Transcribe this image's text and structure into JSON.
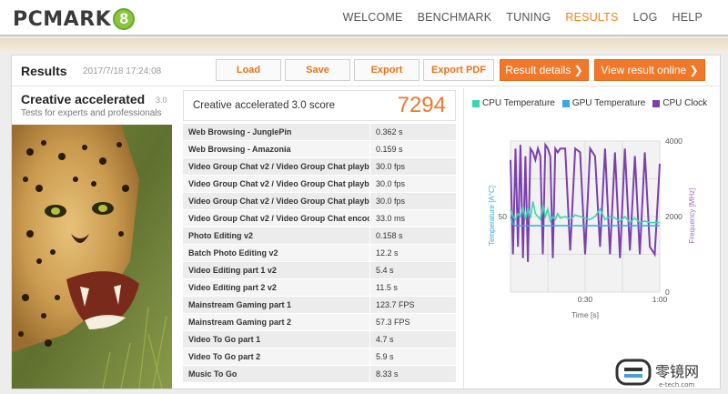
{
  "app": {
    "logo_text": "PCMARK",
    "logo_badge": "8"
  },
  "nav": {
    "items": [
      {
        "label": "WELCOME",
        "active": false
      },
      {
        "label": "BENCHMARK",
        "active": false
      },
      {
        "label": "TUNING",
        "active": false
      },
      {
        "label": "RESULTS",
        "active": true
      },
      {
        "label": "LOG",
        "active": false
      },
      {
        "label": "HELP",
        "active": false
      }
    ]
  },
  "results": {
    "title": "Results",
    "date": "2017/7/18 17:24:08",
    "buttons": {
      "load": "Load",
      "save": "Save",
      "export": "Export",
      "export_pdf": "Export PDF",
      "result_details": "Result details ❯",
      "view_online": "View result online ❯"
    }
  },
  "test": {
    "name": "Creative accelerated",
    "version": "3.0",
    "description": "Tests for experts and professionals",
    "score_label": "Creative accelerated 3.0 score",
    "score_value": "7294"
  },
  "table": {
    "rows": [
      {
        "name": "Web Browsing - JunglePin",
        "value": "0.362 s"
      },
      {
        "name": "Web Browsing - Amazonia",
        "value": "0.159 s"
      },
      {
        "name": "Video Group Chat v2 / Video Group Chat playb",
        "value": "30.0 fps"
      },
      {
        "name": "Video Group Chat v2 / Video Group Chat playb",
        "value": "30.0 fps"
      },
      {
        "name": "Video Group Chat v2 / Video Group Chat playb",
        "value": "30.0 fps"
      },
      {
        "name": "Video Group Chat v2 / Video Group Chat encoc",
        "value": "33.0 ms"
      },
      {
        "name": "Photo Editing v2",
        "value": "0.158 s"
      },
      {
        "name": "Batch Photo Editing v2",
        "value": "12.2 s"
      },
      {
        "name": "Video Editing part 1 v2",
        "value": "5.4 s"
      },
      {
        "name": "Video Editing part 2 v2",
        "value": "11.5 s"
      },
      {
        "name": "Mainstream Gaming part 1",
        "value": "123.7 FPS"
      },
      {
        "name": "Mainstream Gaming part 2",
        "value": "57.3 FPS"
      },
      {
        "name": "Video To Go part 1",
        "value": "4.7 s"
      },
      {
        "name": "Video To Go part 2",
        "value": "5.9 s"
      },
      {
        "name": "Music To Go",
        "value": "8.33 s"
      }
    ]
  },
  "colors": {
    "cpu_temp": "#3dd6b0",
    "gpu_temp": "#35a9e0",
    "cpu_clock": "#7b3fb0",
    "accent": "#f0782a"
  },
  "chart_data": {
    "type": "line",
    "legend": [
      "CPU Temperature",
      "GPU Temperature",
      "CPU Clock"
    ],
    "xlabel": "Time [s]",
    "ylabel_left": "Temperature [A°C]",
    "ylabel_right": "Frequency [MHz]",
    "x_ticks": [
      "0:30",
      "1:00"
    ],
    "y_left_ticks": [
      "50"
    ],
    "y_right_ticks": [
      "4000",
      "2000",
      "0"
    ],
    "xlim": [
      0,
      60
    ],
    "ylim_left": [
      0,
      100
    ],
    "ylim_right": [
      0,
      4000
    ],
    "grid": true,
    "series": [
      {
        "name": "CPU Temperature",
        "axis": "left",
        "x": [
          0,
          1,
          2,
          3,
          4,
          5,
          6,
          7,
          8,
          9,
          10,
          11,
          12,
          13,
          14,
          15,
          16,
          17,
          18,
          19,
          20,
          22,
          24,
          26,
          28,
          30,
          32,
          34,
          36,
          38,
          40,
          42,
          44,
          46,
          48,
          50,
          52,
          54,
          56,
          58,
          60
        ],
        "y": [
          55,
          50,
          48,
          52,
          50,
          57,
          48,
          56,
          49,
          60,
          52,
          50,
          48,
          58,
          50,
          55,
          47,
          50,
          48,
          52,
          49,
          50,
          48,
          51,
          50,
          49,
          48,
          50,
          55,
          48,
          50,
          49,
          47,
          50,
          46,
          49,
          46,
          47,
          46,
          46,
          46
        ]
      },
      {
        "name": "GPU Temperature",
        "axis": "left",
        "x": [
          0,
          1,
          2,
          3,
          5,
          10,
          20,
          30,
          40,
          50,
          60
        ],
        "y": [
          50,
          45,
          44,
          44,
          44,
          44,
          44,
          44,
          44,
          44,
          44
        ]
      },
      {
        "name": "CPU Clock",
        "axis": "right",
        "x": [
          0,
          1,
          2,
          3,
          4,
          5,
          6,
          7,
          8,
          9,
          10,
          11,
          12,
          13,
          14,
          15,
          16,
          17,
          18,
          19,
          20,
          22,
          24,
          26,
          28,
          30,
          32,
          34,
          36,
          38,
          40,
          42,
          44,
          46,
          48,
          50,
          52,
          54,
          56,
          58,
          60
        ],
        "y": [
          3500,
          1000,
          3800,
          1200,
          3900,
          900,
          3600,
          800,
          3800,
          3700,
          3500,
          3800,
          3600,
          1000,
          3900,
          3800,
          3600,
          900,
          3800,
          3700,
          3800,
          3800,
          1100,
          3800,
          3700,
          1000,
          3800,
          3600,
          1200,
          3800,
          1000,
          3700,
          900,
          3800,
          1100,
          3600,
          1000,
          3700,
          1200,
          1000,
          3400
        ]
      }
    ]
  }
}
